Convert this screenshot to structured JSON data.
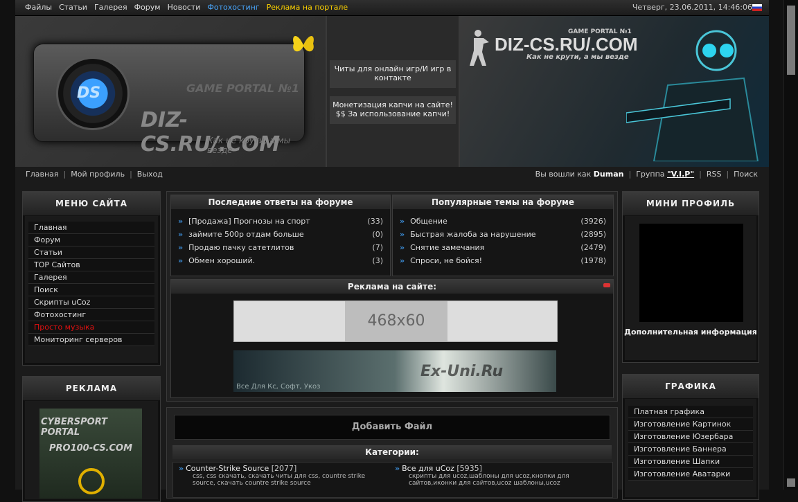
{
  "topbar": {
    "nav": [
      "Файлы",
      "Статьи",
      "Галерея",
      "Форум",
      "Новости",
      "Фотохостинг",
      "Реклама на портале"
    ],
    "datetime": "Четверг, 23.06.2011, 14:46:06"
  },
  "header": {
    "logo_abbr": "DS",
    "logo_tagline": "GAME PORTAL №1",
    "logo_title": "DIZ-CS.RU/.COM",
    "logo_slogan": "Как не крути, а мы везде",
    "mid_link1": "Читы для онлайн игр/И игр в контакте",
    "mid_link2": "Монетизация капчи на сайте! $$ За использование капчи!",
    "banner_gp": "GAME PORTAL №1",
    "banner_title": "DIZ-CS.RU/.COM",
    "banner_slogan": "Как не крути, а мы везде"
  },
  "subnav": {
    "home": "Главная",
    "profile": "Мой профиль",
    "logout": "Выход",
    "logged_as": "Вы вошли как",
    "username": "Duman",
    "group_label": "Группа",
    "group": "\"V.I.P\"",
    "rss": "RSS",
    "search": "Поиск"
  },
  "site_menu": {
    "title": "МЕНЮ САЙТА",
    "items": [
      "Главная",
      "Форум",
      "Статьи",
      "TOP Сайтов",
      "Галерея",
      "Поиск",
      "Скрипты uCoz",
      "Фотохостинг",
      "Просто музыка",
      "Мониторинг серверов"
    ]
  },
  "ad_box": {
    "title": "РЕКЛАМА",
    "line1": "CYBERSPORT PORTAL",
    "line2": "PRO100-CS.COM"
  },
  "forum_latest": {
    "title": "Последние ответы на форуме",
    "rows": [
      {
        "t": "[Продажа] Прогнозы на спорт",
        "c": "(33)"
      },
      {
        "t": "займите 500р отдам больше",
        "c": "(0)"
      },
      {
        "t": "Продаю пачку сатетлитов",
        "c": "(7)"
      },
      {
        "t": "Обмен хороший.",
        "c": "(3)"
      }
    ]
  },
  "forum_popular": {
    "title": "Популярные темы на форуме",
    "rows": [
      {
        "t": "Общение",
        "c": "(3926)"
      },
      {
        "t": "Быстрая жалоба за нарушение",
        "c": "(2895)"
      },
      {
        "t": "Снятие замечания",
        "c": "(2479)"
      },
      {
        "t": "Спроси, не бойся!",
        "c": "(1978)"
      }
    ]
  },
  "site_ads": {
    "title": "Реклама на сайте:",
    "banner1": "468x60",
    "banner2_caption": "Все Для Кс, Софт, Укоз",
    "banner2_brand": "Ex-Uni.Ru"
  },
  "files": {
    "add_button": "Добавить Файл",
    "categories_title": "Категории:",
    "categories": [
      {
        "name": "Counter-Strike Source",
        "count": "[2077]",
        "desc": "css, css скачать, скачать читы для css, countre strike source, скачать countre strike source"
      },
      {
        "name": "Все для uCoz",
        "count": "[5935]",
        "desc": "скрипты для ucoz,шаблоны для ucoz,кнопки для сайтов,иконки для сайтов,ucoz шаблоны,ucoz"
      }
    ]
  },
  "mini_profile": {
    "title": "МИНИ ПРОФИЛЬ",
    "info": "Дополнительная информация"
  },
  "graphics": {
    "title": "ГРАФИКА",
    "items": [
      "Платная графика",
      "Изготовление Картинок",
      "Изготовление Юзербара",
      "Изготовление Баннера",
      "Изготовление Шапки",
      "Изготовление Аватарки"
    ]
  }
}
